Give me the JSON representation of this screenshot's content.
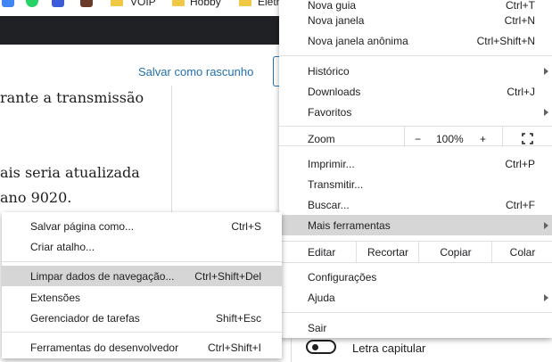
{
  "bookmarks": [
    {
      "label": "VOIP"
    },
    {
      "label": "Hobby"
    },
    {
      "label": "Eletr"
    }
  ],
  "editor": {
    "save_draft": "Salvar como rascunho",
    "lines": [
      "rante a transmissão",
      "ais seria atualizada",
      "ano 9020."
    ],
    "dropcap_label": "Letra capitular"
  },
  "menu": {
    "items_top": [
      {
        "label": "Nova guia",
        "shortcut": "Ctrl+T"
      },
      {
        "label": "Nova janela",
        "shortcut": "Ctrl+N"
      },
      {
        "label": "Nova janela anônima",
        "shortcut": "Ctrl+Shift+N"
      }
    ],
    "items_history": [
      {
        "label": "Histórico",
        "shortcut": ""
      },
      {
        "label": "Downloads",
        "shortcut": "Ctrl+J"
      },
      {
        "label": "Favoritos",
        "shortcut": ""
      }
    ],
    "zoom": {
      "label": "Zoom",
      "minus": "−",
      "value": "100%",
      "plus": "+"
    },
    "items_print": [
      {
        "label": "Imprimir...",
        "shortcut": "Ctrl+P"
      },
      {
        "label": "Transmitir...",
        "shortcut": ""
      },
      {
        "label": "Buscar...",
        "shortcut": "Ctrl+F"
      },
      {
        "label": "Mais ferramentas",
        "shortcut": ""
      }
    ],
    "edit": {
      "label": "Editar",
      "cut": "Recortar",
      "copy": "Copiar",
      "paste": "Colar"
    },
    "items_settings": [
      {
        "label": "Configurações",
        "shortcut": ""
      },
      {
        "label": "Ajuda",
        "shortcut": ""
      }
    ],
    "exit": {
      "label": "Sair"
    }
  },
  "submenu": {
    "items": [
      {
        "label": "Salvar página como...",
        "shortcut": "Ctrl+S"
      },
      {
        "label": "Criar atalho..."
      },
      {
        "label": "Limpar dados de navegação...",
        "shortcut": "Ctrl+Shift+Del"
      },
      {
        "label": "Extensões"
      },
      {
        "label": "Gerenciador de tarefas",
        "shortcut": "Shift+Esc"
      },
      {
        "label": "Ferramentas do desenvolvedor",
        "shortcut": "Ctrl+Shift+I"
      }
    ]
  },
  "colors": {
    "highlight": "#d6d6d6",
    "link_blue": "#2271b1",
    "dark_bar": "#1f2124"
  }
}
